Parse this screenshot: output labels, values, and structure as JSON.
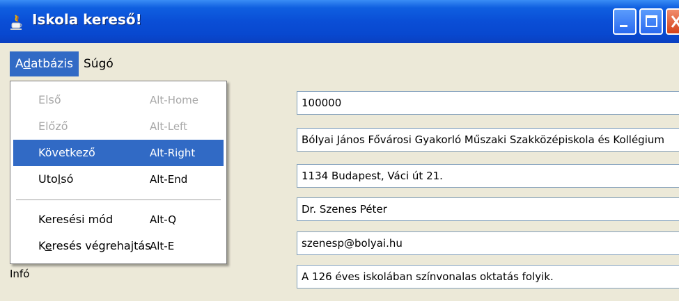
{
  "window": {
    "title": "Iskola kereső!",
    "controls": {
      "minimize": "minimize-icon",
      "maximize": "maximize-icon",
      "close": "close-icon"
    }
  },
  "menubar": {
    "items": [
      {
        "pre": "A",
        "u": "d",
        "post": "atbázis"
      },
      {
        "label": "Súgó"
      }
    ]
  },
  "dropdown": {
    "items": [
      {
        "label": "Első",
        "accel": "Alt-Home"
      },
      {
        "label": "Előző",
        "accel": "Alt-Left"
      },
      {
        "label": "Következő",
        "accel": "Alt-Right"
      },
      {
        "pre": "Uto",
        "u": "l",
        "post": "só",
        "accel": "Alt-End"
      },
      {
        "label": "Keresési mód",
        "accel": "Alt-Q"
      },
      {
        "pre": "K",
        "u": "e",
        "post": "resés végrehajtás",
        "accel": "Alt-E"
      }
    ]
  },
  "form": {
    "fields": [
      "100000",
      "Bólyai János Fővárosi Gyakorló Műszaki Szakközépiskola és Kollégium",
      "1134 Budapest, Váci út 21.",
      "Dr. Szenes Péter",
      "szenesp@bolyai.hu",
      "A 126 éves iskolában színvonalas oktatás folyik."
    ],
    "info_label": "Infó"
  },
  "colors": {
    "titlebar": "#0a4ed6",
    "selection": "#316ac5",
    "background": "#ece9d8"
  }
}
